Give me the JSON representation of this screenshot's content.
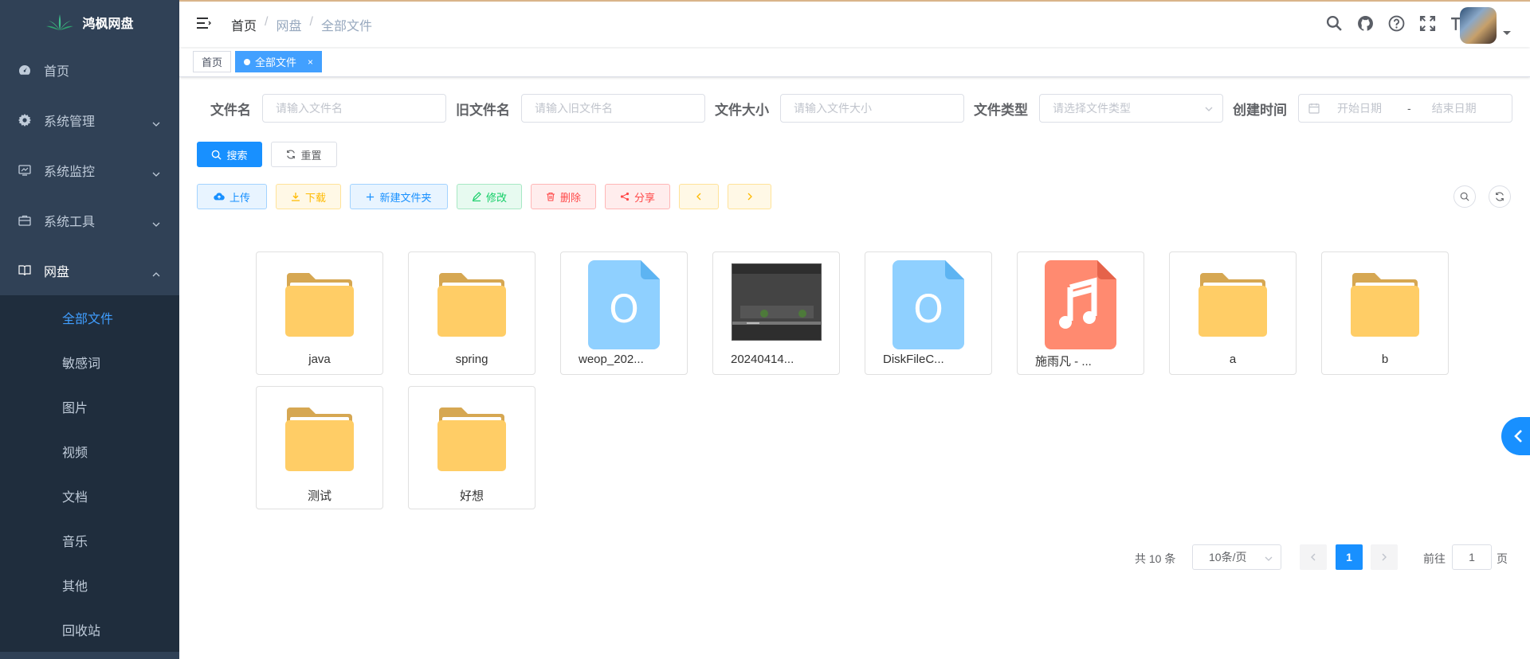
{
  "app": {
    "title": "鸿枫网盘"
  },
  "sidebar": {
    "items": [
      {
        "label": "首页",
        "icon": "dashboard-icon"
      },
      {
        "label": "系统管理",
        "icon": "gear-icon"
      },
      {
        "label": "系统监控",
        "icon": "monitor-icon"
      },
      {
        "label": "系统工具",
        "icon": "toolbox-icon"
      },
      {
        "label": "网盘",
        "icon": "book-icon"
      }
    ],
    "submenu": [
      {
        "label": "全部文件"
      },
      {
        "label": "敏感词"
      },
      {
        "label": "图片"
      },
      {
        "label": "视频"
      },
      {
        "label": "文档"
      },
      {
        "label": "音乐"
      },
      {
        "label": "其他"
      },
      {
        "label": "回收站"
      }
    ]
  },
  "breadcrumb": [
    "首页",
    "网盘",
    "全部文件"
  ],
  "tags": [
    {
      "label": "首页"
    },
    {
      "label": "全部文件",
      "close": "×"
    }
  ],
  "search": {
    "filename_label": "文件名",
    "filename_placeholder": "请输入文件名",
    "oldname_label": "旧文件名",
    "oldname_placeholder": "请输入旧文件名",
    "size_label": "文件大小",
    "size_placeholder": "请输入文件大小",
    "type_label": "文件类型",
    "type_placeholder": "请选择文件类型",
    "created_label": "创建时间",
    "start_placeholder": "开始日期",
    "range_sep": "-",
    "end_placeholder": "结束日期",
    "search_btn": "搜索",
    "reset_btn": "重置"
  },
  "toolbar": {
    "upload": "上传",
    "download": "下载",
    "new_folder": "新建文件夹",
    "edit": "修改",
    "delete": "删除",
    "share": "分享"
  },
  "files": [
    {
      "name": "java",
      "type": "folder"
    },
    {
      "name": "spring",
      "type": "folder"
    },
    {
      "name": "weop_202...",
      "type": "file",
      "glyph": "O"
    },
    {
      "name": "20240414...",
      "type": "image"
    },
    {
      "name": "DiskFileC...",
      "type": "file",
      "glyph": "O"
    },
    {
      "name": "施雨凡 - ...",
      "type": "music"
    },
    {
      "name": "a",
      "type": "folder"
    },
    {
      "name": "b",
      "type": "folder"
    },
    {
      "name": "测试",
      "type": "folder"
    },
    {
      "name": "好想",
      "type": "folder"
    }
  ],
  "pagination": {
    "total": "共 10 条",
    "page_size": "10条/页",
    "current": "1",
    "goto_label": "前往",
    "goto_value": "1",
    "page_unit": "页"
  },
  "colors": {
    "sidebar_bg": "#304156",
    "submenu_bg": "#1f2d3d",
    "primary": "#1890ff",
    "folder": "#ffcd66",
    "doc": "#8fd0ff",
    "music": "#ff8a70"
  }
}
